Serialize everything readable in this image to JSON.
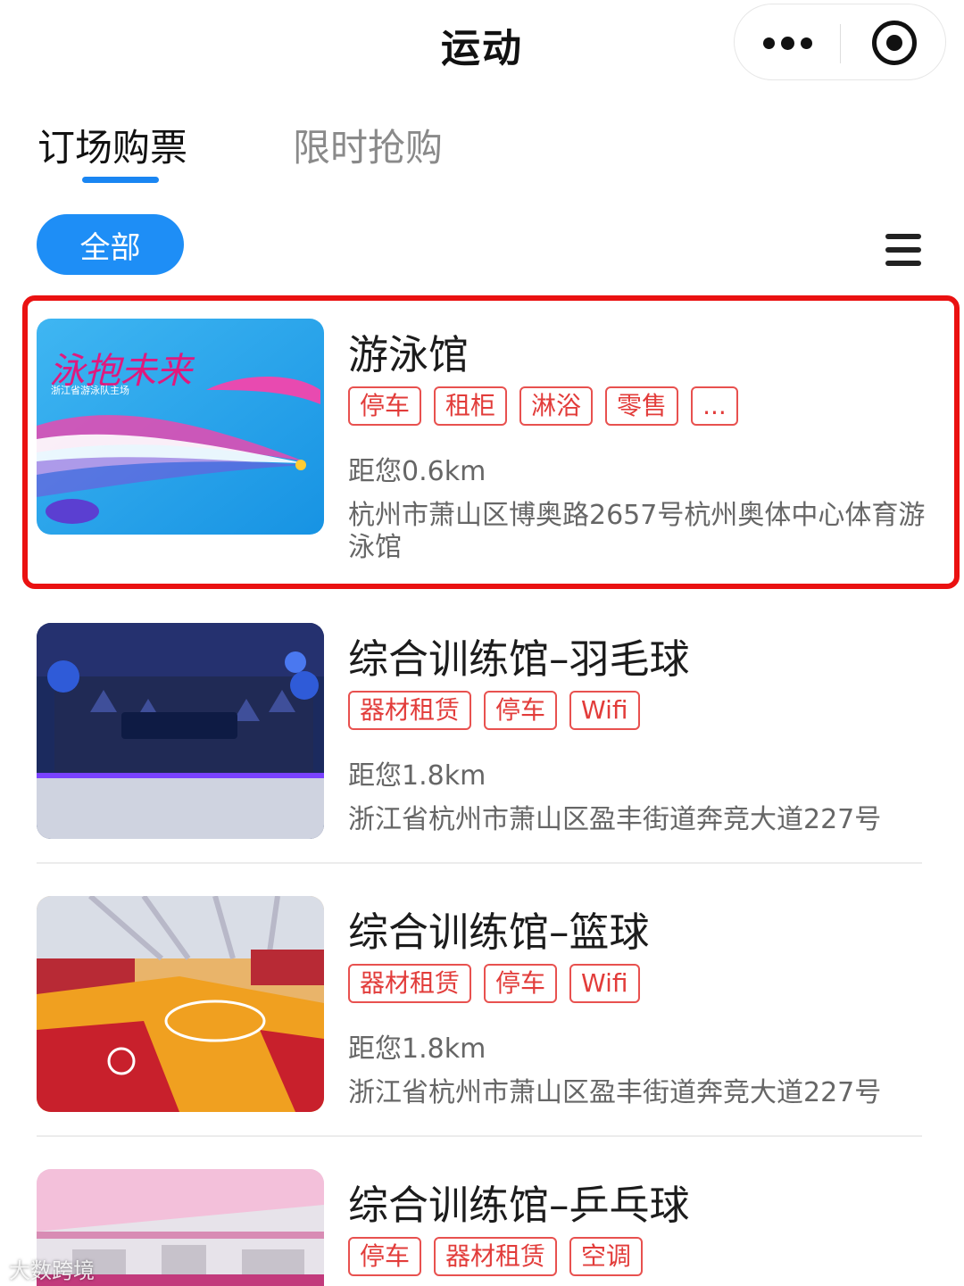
{
  "header": {
    "title": "运动"
  },
  "tabs": {
    "booking": "订场购票",
    "flash_sale": "限时抢购"
  },
  "filter": {
    "all_label": "全部"
  },
  "colors": {
    "accent": "#1e8ef6",
    "tag_red": "#e23c3a",
    "highlight": "#ea1111"
  },
  "venues": [
    {
      "name": "游泳馆",
      "tags": [
        "停车",
        "租柜",
        "淋浴",
        "零售",
        "..."
      ],
      "distance": "距您0.6km",
      "address": "杭州市萧山区博奥路2657号杭州奥体中心体育游泳馆",
      "image_text": {
        "slogan": "泳抱未来",
        "subtitle": "浙江省游泳队主场"
      }
    },
    {
      "name": "综合训练馆–羽毛球",
      "tags": [
        "器材租赁",
        "停车",
        "Wifi"
      ],
      "distance": "距您1.8km",
      "address": "浙江省杭州市萧山区盈丰街道奔竞大道227号"
    },
    {
      "name": "综合训练馆–篮球",
      "tags": [
        "器材租赁",
        "停车",
        "Wifi"
      ],
      "distance": "距您1.8km",
      "address": "浙江省杭州市萧山区盈丰街道奔竞大道227号"
    },
    {
      "name": "综合训练馆–乒乓球",
      "tags": [
        "停车",
        "器材租赁",
        "空调"
      ]
    }
  ],
  "watermark": "大数跨境"
}
